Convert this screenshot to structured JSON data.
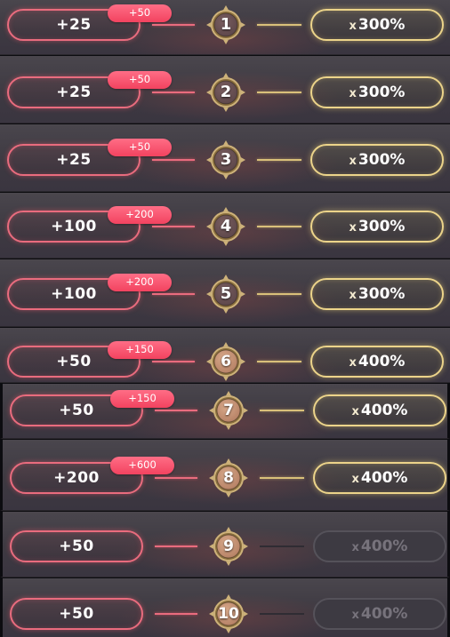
{
  "accent": {
    "reward_outline": "#e96c7e",
    "badge_fill": "#f2435f",
    "multiplier_outline": "#ecd48a",
    "locked_outline": "#55525a",
    "emblem_dark": "#5a4548",
    "emblem_bronze": "#b07a5a"
  },
  "tiers": [
    {
      "level": "1",
      "reward": "+25",
      "bonus": "+50",
      "multiplier_prefix": "x",
      "multiplier": "300%",
      "unlocked": true,
      "emblem": "dark"
    },
    {
      "level": "2",
      "reward": "+25",
      "bonus": "+50",
      "multiplier_prefix": "x",
      "multiplier": "300%",
      "unlocked": true,
      "emblem": "dark"
    },
    {
      "level": "3",
      "reward": "+25",
      "bonus": "+50",
      "multiplier_prefix": "x",
      "multiplier": "300%",
      "unlocked": true,
      "emblem": "dark"
    },
    {
      "level": "4",
      "reward": "+100",
      "bonus": "+200",
      "multiplier_prefix": "x",
      "multiplier": "300%",
      "unlocked": true,
      "emblem": "dark"
    },
    {
      "level": "5",
      "reward": "+100",
      "bonus": "+200",
      "multiplier_prefix": "x",
      "multiplier": "300%",
      "unlocked": true,
      "emblem": "dark"
    },
    {
      "level": "6",
      "reward": "+50",
      "bonus": "+150",
      "multiplier_prefix": "x",
      "multiplier": "400%",
      "unlocked": true,
      "emblem": "bronze"
    },
    {
      "level": "7",
      "reward": "+50",
      "bonus": "+150",
      "multiplier_prefix": "x",
      "multiplier": "400%",
      "unlocked": true,
      "emblem": "bronze"
    },
    {
      "level": "8",
      "reward": "+200",
      "bonus": "+600",
      "multiplier_prefix": "x",
      "multiplier": "400%",
      "unlocked": true,
      "emblem": "bronze"
    },
    {
      "level": "9",
      "reward": "+50",
      "bonus": "",
      "multiplier_prefix": "x",
      "multiplier": "400%",
      "unlocked": false,
      "emblem": "bronze"
    },
    {
      "level": "10",
      "reward": "+50",
      "bonus": "",
      "multiplier_prefix": "x",
      "multiplier": "400%",
      "unlocked": false,
      "emblem": "bronze"
    }
  ]
}
